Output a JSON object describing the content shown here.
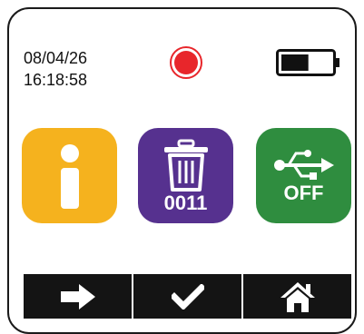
{
  "status": {
    "date": "08/04/26",
    "time": "16:18:58",
    "recording_icon": "record-dot-icon",
    "battery_icon": "battery-icon",
    "battery_level": 0.55
  },
  "tiles": {
    "info": {
      "icon": "info-icon",
      "color": "#f5b21e"
    },
    "trash": {
      "icon": "trash-icon",
      "count": "0011",
      "color": "#56318f"
    },
    "usb": {
      "icon": "usb-icon",
      "state": "OFF",
      "color": "#2f8d3f"
    }
  },
  "nav": {
    "items": [
      {
        "icon": "arrow-right-icon"
      },
      {
        "icon": "checkmark-icon"
      },
      {
        "icon": "home-icon"
      }
    ]
  },
  "colors": {
    "record": "#e8262b",
    "nav_background": "#141414"
  }
}
